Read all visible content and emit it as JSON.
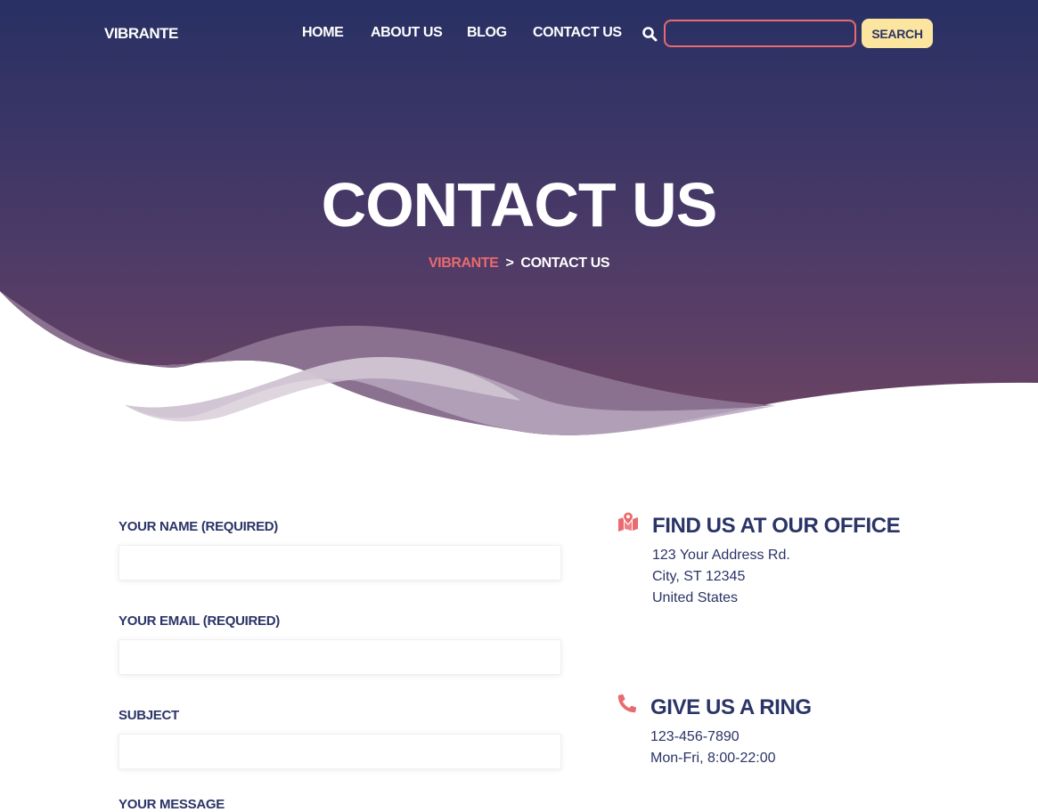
{
  "colors": {
    "navy": "#2b3467",
    "plum": "#6b4264",
    "coral": "#e96a6f",
    "cream": "#fbe59f"
  },
  "header": {
    "logo": "VIBRANTE",
    "nav": [
      "HOME",
      "ABOUT US",
      "BLOG",
      "CONTACT US"
    ],
    "search": {
      "icon": "search-icon",
      "placeholder": "",
      "button_label": "SEARCH"
    }
  },
  "hero": {
    "title": "CONTACT US",
    "breadcrumb": {
      "home": "VIBRANTE",
      "separator": ">",
      "current": "CONTACT US"
    }
  },
  "form": {
    "fields": [
      {
        "label": "YOUR NAME (REQUIRED)",
        "value": ""
      },
      {
        "label": "YOUR EMAIL (REQUIRED)",
        "value": ""
      },
      {
        "label": "SUBJECT",
        "value": ""
      }
    ],
    "message_label": "YOUR MESSAGE"
  },
  "contact_info": {
    "office": {
      "icon": "map-marker-icon",
      "heading": "FIND US AT OUR OFFICE",
      "lines": [
        "123 Your Address Rd.",
        "City, ST 12345",
        "United States"
      ]
    },
    "phone": {
      "icon": "phone-icon",
      "heading": "GIVE US A RING",
      "lines": [
        "123-456-7890",
        "Mon-Fri, 8:00-22:00"
      ]
    }
  }
}
